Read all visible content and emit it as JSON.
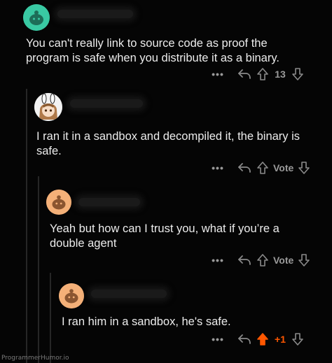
{
  "comments": [
    {
      "text": "You can't really link to source code as proof the program is safe when you distribute it as a binary.",
      "more_label": "•••",
      "vote_label": "13",
      "upvoted": false
    },
    {
      "text": "I ran it in a sandbox and decompiled it, the binary is safe.",
      "more_label": "•••",
      "vote_label": "Vote",
      "upvoted": false
    },
    {
      "text": "Yeah but how can I trust you, what if you’re a double agent",
      "more_label": "•••",
      "vote_label": "Vote",
      "upvoted": false
    },
    {
      "text": "I ran him in a sandbox, he's safe.",
      "more_label": "•••",
      "vote_label": "+1",
      "upvoted": true
    }
  ],
  "watermark": "ProgrammerHumor.io",
  "colors": {
    "background": "#050505",
    "text": "#ececec",
    "muted": "#8a8a8a",
    "upvote_accent": "#ff5700",
    "thread_line": "#262626",
    "avatar_teal": "#39c9a3",
    "avatar_orange": "#f4b078"
  },
  "icons": {
    "more": "more-dots-icon",
    "reply": "reply-arrow-icon",
    "upvote": "upvote-arrow-icon",
    "downvote": "downvote-arrow-icon",
    "avatar": "snoo-avatar-icon"
  }
}
